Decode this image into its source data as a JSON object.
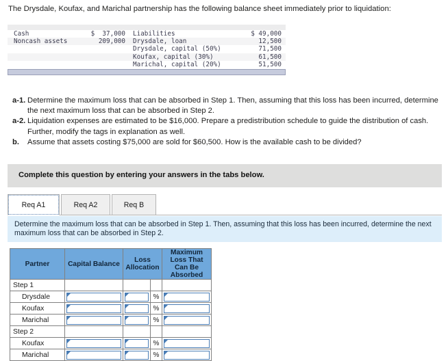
{
  "intro": "The Drysdale, Koufax, and Marichal partnership has the following balance sheet immediately prior to liquidation:",
  "balance_sheet": {
    "rows": [
      {
        "left_label": "Cash",
        "left_amount": "$  37,000",
        "right_label": "Liabilities",
        "right_amount": "$ 49,000"
      },
      {
        "left_label": "Noncash assets",
        "left_amount": "209,000",
        "right_label": "Drysdale, loan",
        "right_amount": "12,500"
      },
      {
        "left_label": "",
        "left_amount": "",
        "right_label": "Drysdale, capital (50%)",
        "right_amount": "71,500"
      },
      {
        "left_label": "",
        "left_amount": "",
        "right_label": "Koufax, capital (30%)",
        "right_amount": "61,500"
      },
      {
        "left_label": "",
        "left_amount": "",
        "right_label": "Marichal, capital (20%)",
        "right_amount": "51,500"
      }
    ]
  },
  "requirements": [
    {
      "tag": "a-1.",
      "text": "Determine the maximum loss that can be absorbed in Step 1. Then, assuming that this loss has been incurred, determine the next maximum loss that can be absorbed in Step 2."
    },
    {
      "tag": "a-2.",
      "text": "Liquidation expenses are estimated to be $16,000. Prepare a predistribution schedule to guide the distribution of cash. Further, modify the tags in explanation as well."
    },
    {
      "tag": "b.",
      "text": "Assume that assets costing $75,000 are sold for $60,500. How is the available cash to be divided?"
    }
  ],
  "banner": {
    "text": "Complete this question by entering your answers in the tabs below."
  },
  "tabs": [
    {
      "label": "Req A1",
      "active": true
    },
    {
      "label": "Req A2",
      "active": false
    },
    {
      "label": "Req B",
      "active": false
    }
  ],
  "sub_instruction": "Determine the maximum loss that can be absorbed in Step 1. Then, assuming that this loss has been incurred, determine the next maximum loss that can be absorbed in Step 2.",
  "answer_table": {
    "headers": [
      "Partner",
      "Capital Balance",
      "Loss Allocation",
      "Maximum Loss That Can Be Absorbed"
    ],
    "rows": [
      {
        "type": "section",
        "label": "Step 1"
      },
      {
        "type": "input",
        "label": "Drysdale",
        "capital": "",
        "loss": "",
        "pct": "%",
        "max": ""
      },
      {
        "type": "input",
        "label": "Koufax",
        "capital": "",
        "loss": "",
        "pct": "%",
        "max": ""
      },
      {
        "type": "input",
        "label": "Marichal",
        "capital": "",
        "loss": "",
        "pct": "%",
        "max": ""
      },
      {
        "type": "section",
        "label": "Step 2"
      },
      {
        "type": "input",
        "label": "Koufax",
        "capital": "",
        "loss": "",
        "pct": "%",
        "max": ""
      },
      {
        "type": "input",
        "label": "Marichal",
        "capital": "",
        "loss": "",
        "pct": "%",
        "max": ""
      }
    ]
  },
  "colors": {
    "header_blue": "#6fa8dc",
    "panel_blue": "#ddeefa",
    "banner_gray": "#dededd",
    "input_border": "#4a7db5"
  }
}
